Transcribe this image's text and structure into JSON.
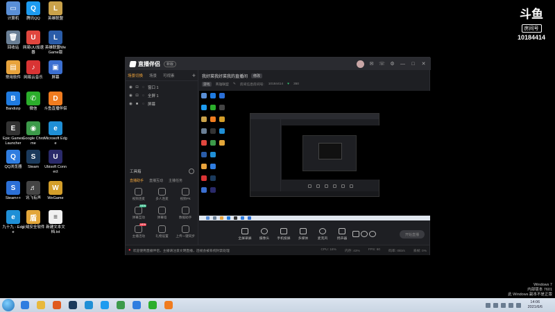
{
  "desktop": {
    "icons": [
      {
        "label": "计算机",
        "glyph": "▭",
        "color": "#5a8fd6"
      },
      {
        "label": "腾讯QQ",
        "glyph": "Q",
        "color": "#1d9bf0"
      },
      {
        "label": "英雄联盟",
        "glyph": "L",
        "color": "#caa24a"
      },
      {
        "label": "回收站",
        "glyph": "🗑",
        "color": "#6a7f95"
      },
      {
        "label": "网易UU加速器",
        "glyph": "U",
        "color": "#e0463e"
      },
      {
        "label": "英雄联盟WeGame版",
        "glyph": "L",
        "color": "#2a5ca8"
      },
      {
        "label": "常用软件",
        "glyph": "▤",
        "color": "#e8a33c"
      },
      {
        "label": "网易云音乐",
        "glyph": "♪",
        "color": "#d93434"
      },
      {
        "label": "屏幕",
        "glyph": "▣",
        "color": "#3b6fd0"
      },
      {
        "label": "Bandizip",
        "glyph": "B",
        "color": "#1f7be0"
      },
      {
        "label": "微信",
        "glyph": "✆",
        "color": "#2bae2b"
      },
      {
        "label": "斗鱼直播伴侣",
        "glyph": "D",
        "color": "#f07c1f"
      },
      {
        "label": "Epic Games Launcher",
        "glyph": "E",
        "color": "#333333"
      },
      {
        "label": "Google Chrome",
        "glyph": "◉",
        "color": "#3c9a4a"
      },
      {
        "label": "Microsoft Edge",
        "glyph": "e",
        "color": "#1f8fd6"
      },
      {
        "label": "QQ浏览器",
        "glyph": "Q",
        "color": "#2f7de0"
      },
      {
        "label": "Steam",
        "glyph": "S",
        "color": "#1b3a5c"
      },
      {
        "label": "Ubisoft Connect",
        "glyph": "U",
        "color": "#2a2a6a"
      },
      {
        "label": "Steam++",
        "glyph": "S",
        "color": "#2b6fd6"
      },
      {
        "label": "讯飞有声",
        "glyph": "♬",
        "color": "#444444"
      },
      {
        "label": "WeGame",
        "glyph": "W",
        "color": "#d39e2a"
      },
      {
        "label": "九十九 - Edge",
        "glyph": "e",
        "color": "#1f8fd6"
      },
      {
        "label": "火绒安全软件",
        "glyph": "盾",
        "color": "#e2a63a"
      },
      {
        "label": "新建文本文档.txt",
        "glyph": "≡",
        "color": "#f0f0f0"
      }
    ],
    "stream_logo": {
      "mark": "斗鱼",
      "room_label": "房间号",
      "room_number": "10184414"
    },
    "watermark": [
      "Windows 7",
      "内部版本 7601",
      "此 Windows 副本不是正版"
    ]
  },
  "app": {
    "name": "直播伴侣",
    "version_badge": "新版",
    "scene_tabs": [
      "场景切换",
      "场景",
      "可视素"
    ],
    "sources": [
      {
        "label": "窗口 1",
        "lock": "⊡"
      },
      {
        "label": "全屏 1",
        "lock": "⊡"
      },
      {
        "label": "屏幕",
        "lock": "■"
      }
    ],
    "tools_title": "工具箱",
    "tool_tabs": [
      "直播助手",
      "直播互动",
      "主播任务"
    ],
    "tools": [
      {
        "label": "视频连麦",
        "badge": ""
      },
      {
        "label": "多人连麦",
        "badge": ""
      },
      {
        "label": "视频PK",
        "badge": ""
      },
      {
        "label": "弹幕互动",
        "badge": "NEW"
      },
      {
        "label": "弹幕墙",
        "badge": ""
      },
      {
        "label": "数据助手",
        "badge": ""
      },
      {
        "label": "主播活动",
        "badge": "NEW"
      },
      {
        "label": "礼物设置",
        "badge": ""
      },
      {
        "label": "上传一键同步",
        "badge": ""
      }
    ],
    "stream_title": "我好菜我好菜我的直播间",
    "stream_tag": "修改",
    "category": "游戏",
    "subcategory": "英雄联盟",
    "room_label": "房间信息房间号:",
    "room_id": "10184414",
    "follow_count": "350",
    "controls": [
      "全屏录屏",
      "摄像头",
      "手机投屏",
      "多媒体",
      "麦克风",
      "扬声器"
    ],
    "start_label": "开始直播",
    "status_notice": "欢迎使用直播伴侣，主播请注意文明直播，违规会被系统封禁处理",
    "stats": [
      "CPU: 18%",
      "内存: 43%",
      "FPS: 60",
      "码率: 0kb/s",
      "丢帧: 0%"
    ]
  },
  "taskbar": {
    "apps": [
      {
        "name": "ie-app",
        "color": "#2f7de0"
      },
      {
        "name": "explorer-app",
        "color": "#e8b83c"
      },
      {
        "name": "media-app",
        "color": "#e05a1f"
      },
      {
        "name": "steam-app",
        "color": "#1b3a5c"
      },
      {
        "name": "edge-app",
        "color": "#1f8fd6"
      },
      {
        "name": "qq-app",
        "color": "#1d9bf0"
      },
      {
        "name": "chrome-app",
        "color": "#3c9a4a"
      },
      {
        "name": "qqbrowser-app",
        "color": "#2f7de0"
      },
      {
        "name": "wechat-app",
        "color": "#2bae2b"
      },
      {
        "name": "douyu-app",
        "color": "#f07c1f"
      }
    ],
    "time": "14:06",
    "date": "2021/6/6"
  }
}
